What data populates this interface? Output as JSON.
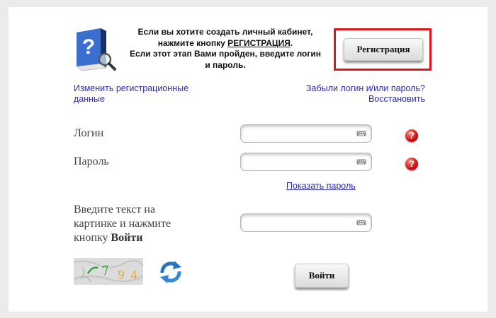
{
  "intro": {
    "line1": "Если вы хотите создать личный кабинет,",
    "line2_prefix": "нажмите кнопку ",
    "line2_link": "РЕГИСТРАЦИЯ",
    "line2_suffix": ".",
    "line3": "Если этот этап Вами пройден, введите логин",
    "line4": "и пароль."
  },
  "register_button": "Регистрация",
  "links": {
    "change_reg_data": "Изменить регистрационные данные",
    "forgot_line1": "Забыли логин и/или пароль?",
    "forgot_line2": "Восстановить",
    "show_password": "Показать пароль"
  },
  "form": {
    "login_label": "Логин",
    "password_label": "Пароль",
    "login_value": "",
    "password_value": "",
    "captcha_prompt_line1": "Введите текст на",
    "captcha_prompt_line2": "картинке и нажмите",
    "captcha_prompt_line3_prefix": "кнопку ",
    "captcha_prompt_line3_bold": "Войти",
    "captcha_value": ""
  },
  "captcha_image_text": "7 9 4",
  "login_button": "Войти",
  "icons": [
    "help-book-icon",
    "keyboard-icon",
    "help-question-icon",
    "refresh-icon"
  ],
  "colors": {
    "highlight_frame": "#e0151b",
    "link": "#2a2ab0",
    "question_icon": "#c8101a"
  }
}
